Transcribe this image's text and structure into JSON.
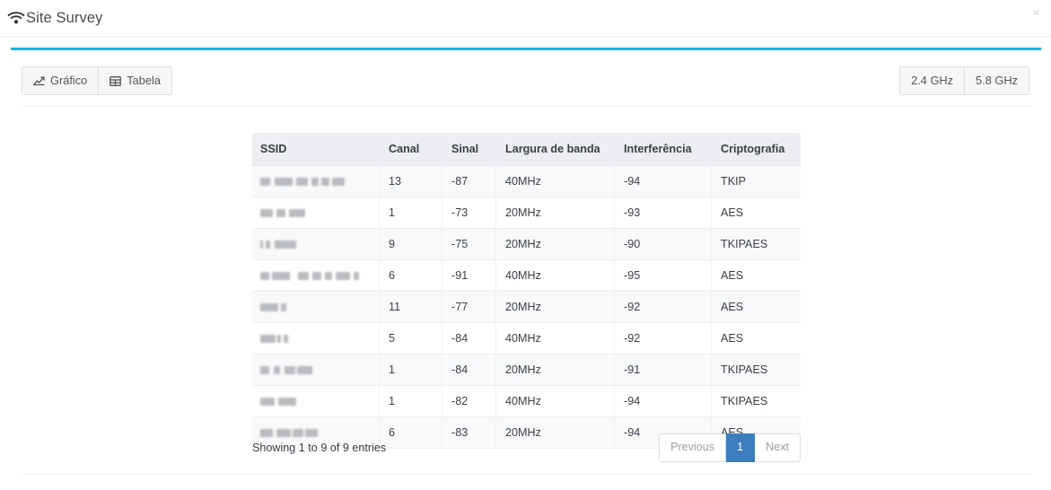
{
  "header": {
    "title": "Site Survey",
    "wifi_icon": "wifi-icon",
    "close_label": "×"
  },
  "theme": {
    "accent": "#00b7ef",
    "pagination_active": "#3c7ebb",
    "header_row_bg": "#eceef1",
    "stripe_bg": "#f8f9fa"
  },
  "toolbar": {
    "view_buttons": [
      {
        "label": "Gráfico",
        "icon": "line-chart-icon"
      },
      {
        "label": "Tabela",
        "icon": "table-grid-icon"
      }
    ],
    "band_buttons": [
      {
        "label": "2.4 GHz"
      },
      {
        "label": "5.8 GHz"
      }
    ]
  },
  "table": {
    "columns": [
      "SSID",
      "Canal",
      "Sinal",
      "Largura de banda",
      "Interferência",
      "Criptografia"
    ],
    "rows": [
      {
        "ssid": "",
        "ssid_redacted": true,
        "ssid_blocks": [
          [
            0,
            11
          ],
          [
            16,
            20
          ],
          [
            40,
            13
          ],
          [
            57,
            8
          ],
          [
            68,
            9
          ],
          [
            80,
            14
          ]
        ],
        "canal": "13",
        "sinal": "-87",
        "largura": "40MHz",
        "interferencia": "-94",
        "criptografia": "TKIP"
      },
      {
        "ssid": "",
        "ssid_redacted": true,
        "ssid_blocks": [
          [
            0,
            14
          ],
          [
            18,
            10
          ],
          [
            32,
            18
          ]
        ],
        "canal": "1",
        "sinal": "-73",
        "largura": "20MHz",
        "interferencia": "-93",
        "criptografia": "AES"
      },
      {
        "ssid": "",
        "ssid_redacted": true,
        "ssid_blocks": [
          [
            0,
            3
          ],
          [
            6,
            5
          ],
          [
            16,
            24
          ]
        ],
        "canal": "9",
        "sinal": "-75",
        "largura": "20MHz",
        "interferencia": "-90",
        "criptografia": "TKIPAES"
      },
      {
        "ssid": "",
        "ssid_redacted": true,
        "ssid_blocks": [
          [
            0,
            10
          ],
          [
            13,
            20
          ],
          [
            42,
            12
          ],
          [
            58,
            10
          ],
          [
            72,
            8
          ],
          [
            84,
            16
          ],
          [
            104,
            6
          ]
        ],
        "canal": "6",
        "sinal": "-91",
        "largura": "40MHz",
        "interferencia": "-95",
        "criptografia": "AES"
      },
      {
        "ssid": "",
        "ssid_redacted": true,
        "ssid_blocks": [
          [
            0,
            20
          ],
          [
            23,
            6
          ]
        ],
        "canal": "11",
        "sinal": "-77",
        "largura": "20MHz",
        "interferencia": "-92",
        "criptografia": "AES"
      },
      {
        "ssid": "",
        "ssid_redacted": true,
        "ssid_blocks": [
          [
            0,
            17
          ],
          [
            19,
            4
          ],
          [
            26,
            5
          ]
        ],
        "canal": "5",
        "sinal": "-84",
        "largura": "40MHz",
        "interferencia": "-92",
        "criptografia": "AES"
      },
      {
        "ssid": "",
        "ssid_redacted": true,
        "ssid_blocks": [
          [
            0,
            10
          ],
          [
            15,
            7
          ],
          [
            27,
            12
          ],
          [
            41,
            17
          ]
        ],
        "canal": "1",
        "sinal": "-84",
        "largura": "20MHz",
        "interferencia": "-91",
        "criptografia": "TKIPAES"
      },
      {
        "ssid": "",
        "ssid_redacted": true,
        "ssid_blocks": [
          [
            0,
            16
          ],
          [
            20,
            20
          ]
        ],
        "canal": "1",
        "sinal": "-82",
        "largura": "40MHz",
        "interferencia": "-94",
        "criptografia": "TKIPAES"
      },
      {
        "ssid": "",
        "ssid_redacted": true,
        "ssid_blocks": [
          [
            0,
            14
          ],
          [
            18,
            16
          ],
          [
            36,
            12
          ],
          [
            50,
            14
          ]
        ],
        "canal": "6",
        "sinal": "-83",
        "largura": "20MHz",
        "interferencia": "-94",
        "criptografia": "AES"
      }
    ]
  },
  "footer": {
    "entries_info": "Showing 1 to 9 of 9 entries",
    "pagination": {
      "previous_label": "Previous",
      "pages": [
        "1"
      ],
      "active_page": "1",
      "next_label": "Next"
    }
  }
}
